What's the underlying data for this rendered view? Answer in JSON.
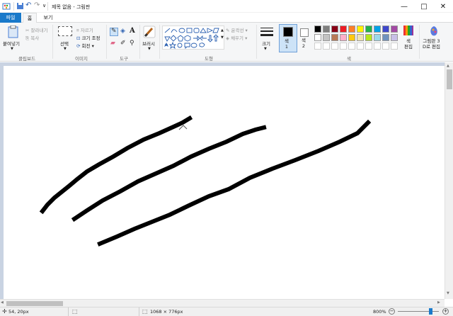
{
  "window": {
    "title": "제목 없음 - 그림판",
    "buttons": {
      "minimize": "—",
      "maximize": "□",
      "close": "✕"
    }
  },
  "quick_access": {
    "save_icon": "save-icon",
    "undo_icon": "undo-icon",
    "redo_icon": "redo-icon",
    "customize": "∨"
  },
  "tabs": [
    {
      "label": "파일",
      "active": true
    },
    {
      "label": "홈",
      "active": false
    },
    {
      "label": "보기",
      "active": false
    }
  ],
  "ribbon": {
    "clipboard": {
      "paste": "붙여넣기",
      "cut": "잘라내기",
      "copy": "복사",
      "group": "클립보드"
    },
    "image": {
      "select": "선택",
      "crop": "자르기",
      "resize": "크기 조정",
      "rotate": "회전",
      "group": "이미지"
    },
    "tools": {
      "group": "도구",
      "text": "A"
    },
    "brushes": {
      "label": "브러시"
    },
    "shapes": {
      "group": "도형",
      "outline": "윤곽선",
      "fill": "채우기"
    },
    "size": {
      "label": "크기"
    },
    "colors": {
      "color1": "색\n1",
      "color2": "색\n2",
      "edit": "색\n편집",
      "paint3d": "그림판 3\nD로 편집",
      "group": "색",
      "palette": [
        "#000000",
        "#7f7f7f",
        "#880015",
        "#ed1c24",
        "#ff7f27",
        "#fff200",
        "#22b14c",
        "#00a2e8",
        "#3f48cc",
        "#a349a4",
        "#ffffff",
        "#c3c3c3",
        "#b97a57",
        "#ffaec9",
        "#ffc90e",
        "#efe4b0",
        "#b5e61d",
        "#99d9ea",
        "#7092be",
        "#c8bfe7",
        "#ffffff",
        "#ffffff",
        "#ffffff",
        "#ffffff",
        "#ffffff",
        "#ffffff",
        "#ffffff",
        "#ffffff",
        "#ffffff",
        "#ffffff"
      ]
    }
  },
  "status": {
    "cursor": "54, 20px",
    "canvas_size": "1068 × 776px",
    "zoom": "800%",
    "zoom_out": "−",
    "zoom_in": "+"
  },
  "accent": "#1979ca"
}
